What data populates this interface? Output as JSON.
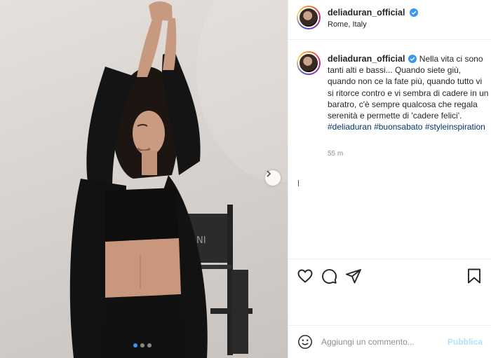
{
  "post": {
    "username": "deliaduran_official",
    "location": "Rome, Italy",
    "verified": true
  },
  "caption": {
    "username": "deliaduran_official",
    "text": "Nella vita ci sono tanti alti e bassi... Quando siete giù, quando non ce la fate più, quando tutto vi si ritorce contro e vi sembra di cadere in un baratro, c'è sempre qualcosa che regala serenità e permette di 'cadere felici'.",
    "hashtags": [
      "#deliaduran",
      "#buonsabato",
      "#styleinspiration"
    ],
    "time": "55 m"
  },
  "photo": {
    "chair_text": "NI",
    "carousel": {
      "total": 3,
      "active": 1
    }
  },
  "actions": {
    "icons": [
      "heart-icon",
      "comment-icon",
      "share-icon",
      "bookmark-icon"
    ]
  },
  "comment_box": {
    "placeholder": "Aggiungi un commento...",
    "publish_label": "Pubblica"
  },
  "colors": {
    "verified": "#3897f0",
    "publish": "#b2dffc",
    "hashtag": "#00376b",
    "time": "#8e8e8e"
  }
}
